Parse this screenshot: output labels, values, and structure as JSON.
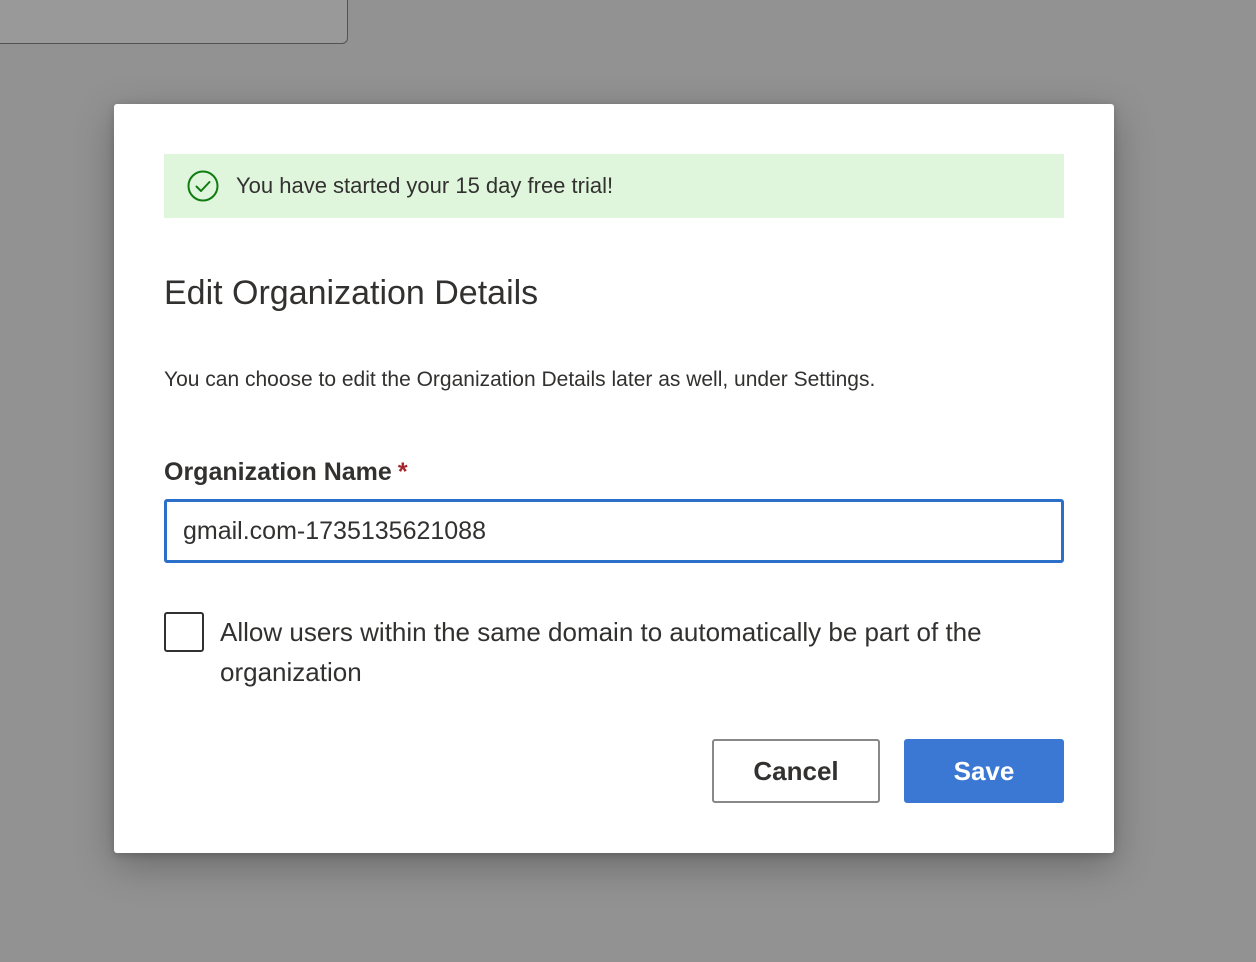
{
  "banner": {
    "icon": "check-circle-icon",
    "message": "You have started your 15 day free trial!",
    "icon_color": "#107c10",
    "background": "#dff6dd"
  },
  "dialog": {
    "title": "Edit Organization Details",
    "description": "You can choose to edit the Organization Details later as well, under Settings."
  },
  "org_name_field": {
    "label": "Organization Name",
    "required_marker": "*",
    "value": "gmail.com-1735135621088"
  },
  "auto_join_checkbox": {
    "label": "Allow users within the same domain to automatically be part of the organization",
    "checked": false
  },
  "actions": {
    "cancel_label": "Cancel",
    "save_label": "Save",
    "primary_color": "#3a78d4"
  }
}
